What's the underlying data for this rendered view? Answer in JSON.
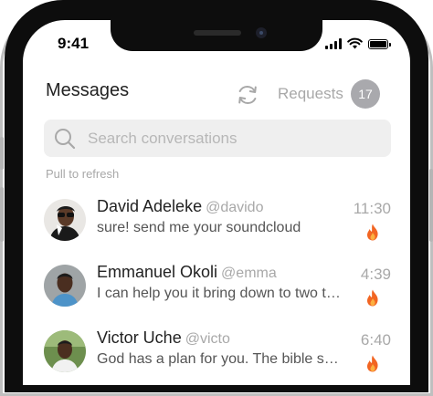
{
  "status_bar": {
    "time": "9:41"
  },
  "header": {
    "title": "Messages",
    "requests_label": "Requests",
    "requests_count": "17"
  },
  "search": {
    "placeholder": "Search conversations"
  },
  "pull_hint": "Pull to refresh",
  "conversations": [
    {
      "name": "David Adeleke",
      "handle": "@davido",
      "preview": "sure! send me your soundcloud",
      "time": "11:30",
      "icon": "fire-icon"
    },
    {
      "name": "Emmanuel Okoli",
      "handle": "@emma",
      "preview": "I can help you it bring down to two thousand",
      "time": "4:39",
      "icon": "fire-icon"
    },
    {
      "name": "Victor Uche",
      "handle": "@victo",
      "preview": "God has a plan for you. The bible says so",
      "time": "6:40",
      "icon": "fire-icon"
    }
  ],
  "colors": {
    "accent_badge": "#a9a9ad",
    "fire": "#f26522",
    "muted_text": "#a8a8a8",
    "search_bg": "#efefef"
  }
}
